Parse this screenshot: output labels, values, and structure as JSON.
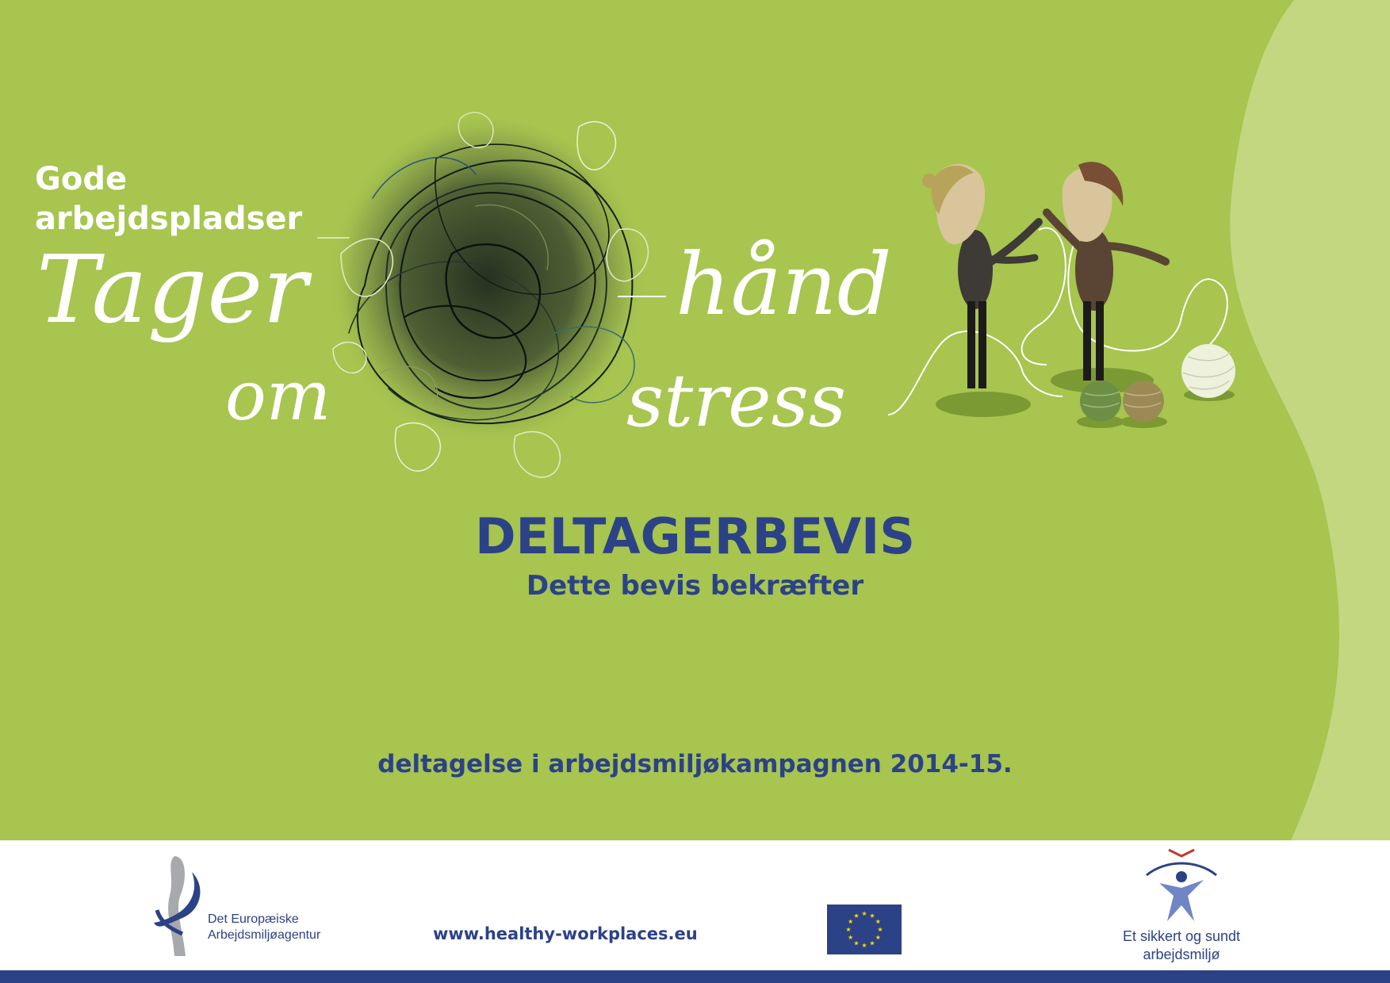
{
  "slogan": {
    "line1": "Gode",
    "line2": "arbejdspladser",
    "script_tager": "Tager",
    "script_om": "om",
    "script_hand": "hånd",
    "script_stress": "stress"
  },
  "certificate": {
    "heading": "DELTAGERBEVIS",
    "subheading": "Dette bevis bekræfter",
    "participation": "deltagelse i arbejdsmiljøkampagnen 2014-15."
  },
  "footer": {
    "agency_name_line1": "Det Europæiske",
    "agency_name_line2": "Arbejdsmiljøagentur",
    "website": "www.healthy-workplaces.eu",
    "campaign_name_line1": "Et sikkert og sundt",
    "campaign_name_line2": "arbejdsmiljø"
  },
  "icons": {
    "agency_logo": "eu-osha-logo-icon",
    "eu_flag": "eu-flag-icon",
    "campaign_logo": "healthy-workplaces-figure-icon"
  },
  "colors": {
    "background_green": "#a7c54f",
    "light_green_wave": "#c2d77f",
    "brand_blue": "#2c4287",
    "white": "#ffffff"
  }
}
